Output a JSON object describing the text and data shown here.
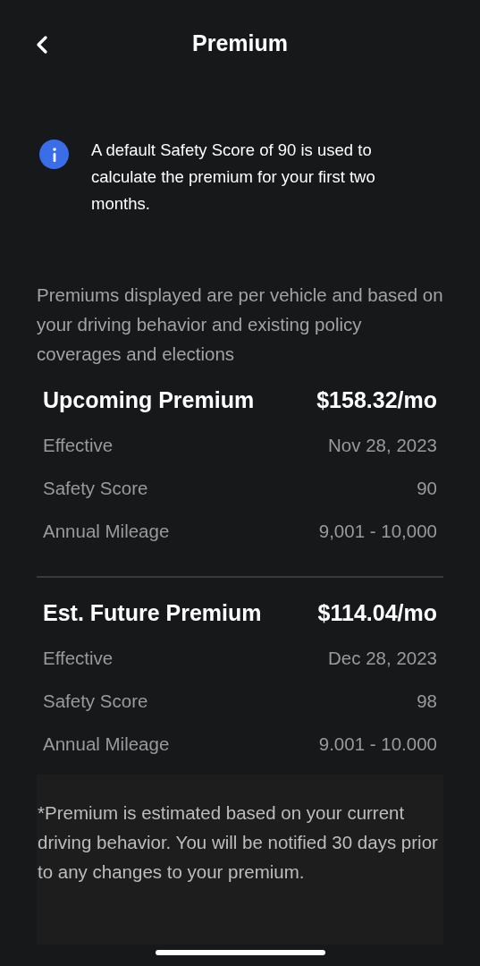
{
  "header": {
    "title": "Premium"
  },
  "info": {
    "text": "A default Safety Score of 90 is used to calculate the premium for your first two months."
  },
  "note": "Premiums displayed are per vehicle and based on your driving behavior and existing policy coverages and elections",
  "sections": [
    {
      "title": "Upcoming Premium",
      "amount": "$158.32/mo",
      "rows": [
        {
          "label": "Effective",
          "value": "Nov 28, 2023"
        },
        {
          "label": "Safety Score",
          "value": "90"
        },
        {
          "label": "Annual Mileage",
          "value": "9,001 - 10,000"
        }
      ]
    },
    {
      "title": "Est. Future Premium",
      "amount": "$114.04/mo",
      "rows": [
        {
          "label": "Effective",
          "value": "Dec 28, 2023"
        },
        {
          "label": "Safety Score",
          "value": "98"
        },
        {
          "label": "Annual Mileage",
          "value": "9.001 - 10.000"
        }
      ]
    }
  ],
  "footnote": "*Premium is estimated based on your current driving behavior. You will be notified 30 days prior to any changes to your premium."
}
